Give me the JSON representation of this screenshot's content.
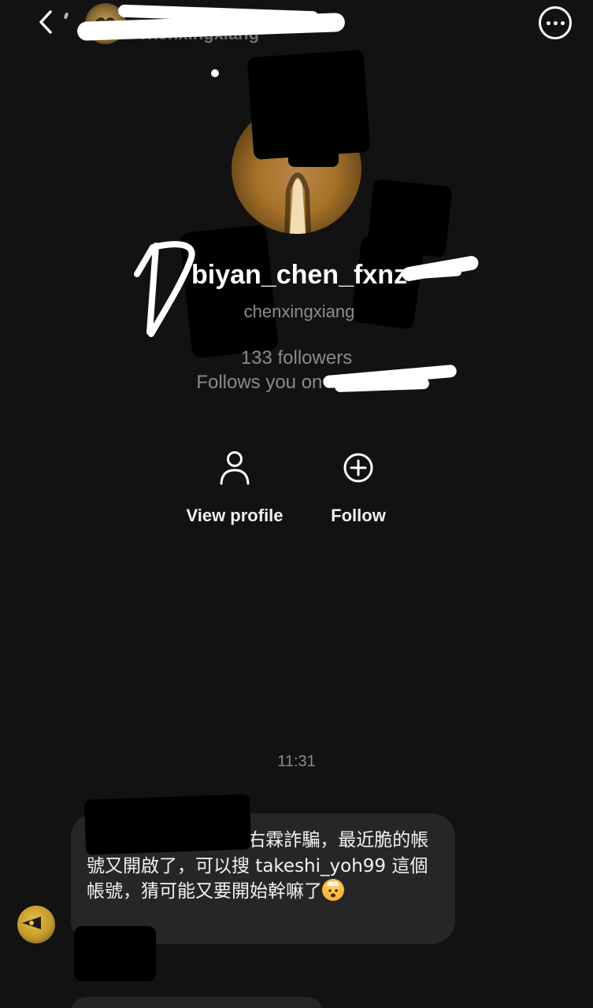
{
  "header": {
    "back_icon": "chevron-left-icon",
    "username": "chenxingxiang",
    "menu_icon": "more-horizontal-icon"
  },
  "profile": {
    "display_name": "biyan_chen_fxnz",
    "username": "chenxingxiang",
    "followers": "133 followers",
    "follows_you": "Follows you on Threads"
  },
  "actions": {
    "view_profile": {
      "label": "View profile",
      "icon": "person-icon"
    },
    "follow": {
      "label": "Follow",
      "icon": "plus-circle-icon"
    }
  },
  "thread": {
    "timestamp": "11:31",
    "messages": [
      {
        "text": "哈囉，你 po 文的楊右霖詐騙，最近脆的帳號又開啟了，可以搜 takeshi_yoh99 這個帳號，猜可能又要開始幹嘛了",
        "emoji": "exploding-head-emoji"
      }
    ]
  }
}
